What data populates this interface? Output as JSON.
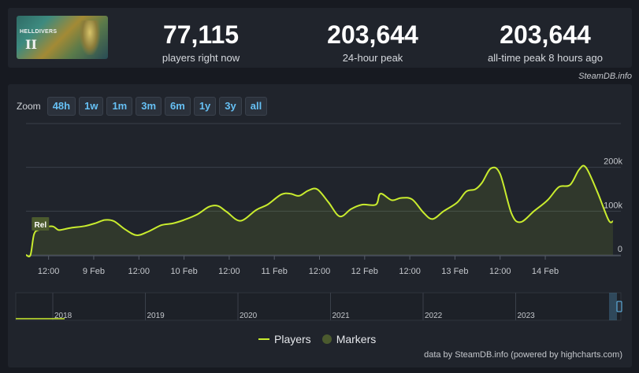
{
  "header": {
    "game_logo_text": "HELLDIVERS",
    "game_logo_numeral": "II",
    "stats": [
      {
        "value": "77,115",
        "label": "players right now"
      },
      {
        "value": "203,644",
        "label": "24-hour peak"
      },
      {
        "value": "203,644",
        "label": "all-time peak 8 hours ago"
      }
    ],
    "credit": "SteamDB.info"
  },
  "zoom": {
    "label": "Zoom",
    "options": [
      "48h",
      "1w",
      "1m",
      "3m",
      "6m",
      "1y",
      "3y",
      "all"
    ]
  },
  "legend": {
    "players": "Players",
    "markers": "Markers"
  },
  "footer_credit": "data by SteamDB.info (powered by highcharts.com)",
  "colors": {
    "series": "#c9ec2e",
    "marker": "#4b5a2e",
    "zoom_text": "#66c0f4"
  },
  "chart_data": {
    "type": "area",
    "series": [
      {
        "name": "Players",
        "points": [
          [
            0.0,
            0
          ],
          [
            0.1,
            0
          ],
          [
            0.18,
            48000
          ],
          [
            0.3,
            58000
          ],
          [
            0.45,
            64000
          ],
          [
            0.6,
            65000
          ],
          [
            0.72,
            57000
          ],
          [
            0.85,
            59000
          ],
          [
            1.0,
            62000
          ],
          [
            1.3,
            66000
          ],
          [
            1.55,
            73000
          ],
          [
            1.75,
            80000
          ],
          [
            1.95,
            77000
          ],
          [
            2.2,
            58000
          ],
          [
            2.45,
            45000
          ],
          [
            2.7,
            53000
          ],
          [
            3.0,
            68000
          ],
          [
            3.25,
            72000
          ],
          [
            3.5,
            80000
          ],
          [
            3.8,
            93000
          ],
          [
            4.05,
            110000
          ],
          [
            4.25,
            112000
          ],
          [
            4.45,
            98000
          ],
          [
            4.75,
            78000
          ],
          [
            5.1,
            103000
          ],
          [
            5.35,
            115000
          ],
          [
            5.65,
            138000
          ],
          [
            5.85,
            140000
          ],
          [
            6.05,
            135000
          ],
          [
            6.25,
            147000
          ],
          [
            6.45,
            150000
          ],
          [
            6.7,
            120000
          ],
          [
            6.95,
            88000
          ],
          [
            7.2,
            105000
          ],
          [
            7.45,
            115000
          ],
          [
            7.75,
            115000
          ],
          [
            7.85,
            140000
          ],
          [
            8.1,
            125000
          ],
          [
            8.3,
            130000
          ],
          [
            8.55,
            127000
          ],
          [
            8.8,
            97000
          ],
          [
            9.0,
            82000
          ],
          [
            9.25,
            100000
          ],
          [
            9.55,
            120000
          ],
          [
            9.75,
            145000
          ],
          [
            9.95,
            150000
          ],
          [
            10.1,
            165000
          ],
          [
            10.3,
            198000
          ],
          [
            10.5,
            185000
          ],
          [
            10.75,
            95000
          ],
          [
            10.95,
            75000
          ],
          [
            11.25,
            100000
          ],
          [
            11.55,
            125000
          ],
          [
            11.8,
            155000
          ],
          [
            12.05,
            160000
          ],
          [
            12.25,
            195000
          ],
          [
            12.4,
            200000
          ],
          [
            12.65,
            145000
          ],
          [
            12.9,
            80000
          ],
          [
            13.0,
            77115
          ]
        ]
      }
    ],
    "markers": [
      {
        "x": 0.18,
        "label": "Rel"
      }
    ],
    "x_ticks": [
      {
        "x": 0.5,
        "label": "12:00"
      },
      {
        "x": 1.5,
        "label": "9 Feb"
      },
      {
        "x": 2.5,
        "label": "12:00"
      },
      {
        "x": 3.5,
        "label": "10 Feb"
      },
      {
        "x": 4.5,
        "label": "12:00"
      },
      {
        "x": 5.5,
        "label": "11 Feb"
      },
      {
        "x": 6.5,
        "label": "12:00"
      },
      {
        "x": 7.5,
        "label": "12 Feb"
      },
      {
        "x": 8.5,
        "label": "12:00"
      },
      {
        "x": 9.5,
        "label": "13 Feb"
      },
      {
        "x": 10.5,
        "label": "12:00"
      },
      {
        "x": 11.5,
        "label": "14 Feb"
      }
    ],
    "xlim": [
      0,
      13
    ],
    "y_ticks": [
      {
        "value": 0,
        "label": "0"
      },
      {
        "value": 100000,
        "label": "100k"
      },
      {
        "value": 200000,
        "label": "200k"
      }
    ],
    "ylim": [
      0,
      300000
    ],
    "navigator_years": [
      "2018",
      "2019",
      "2020",
      "2021",
      "2022",
      "2023"
    ]
  }
}
